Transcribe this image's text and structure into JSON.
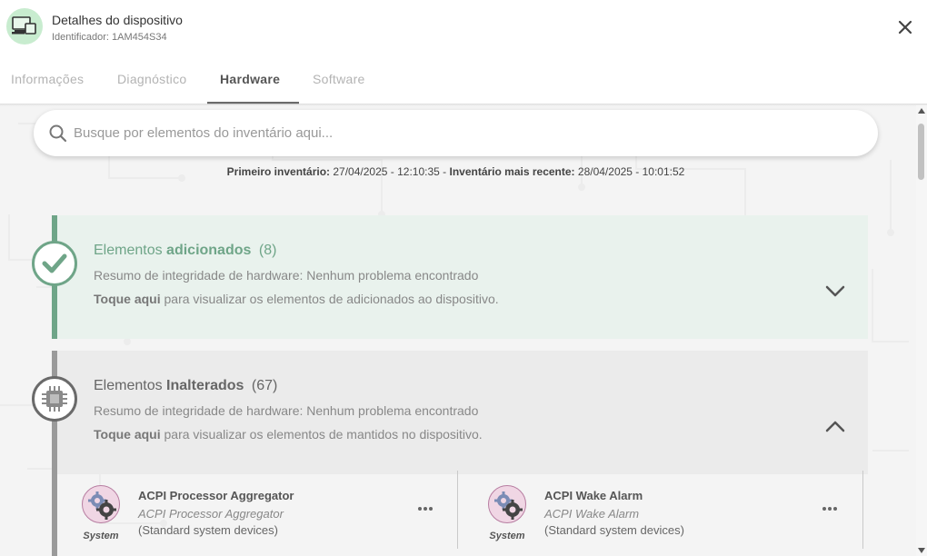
{
  "header": {
    "title": "Detalhes do dispositivo",
    "subtitle": "Identificador: 1AM454S34",
    "icon": "devices-icon",
    "close_icon": "close-icon"
  },
  "tabs": [
    {
      "label": "Informações",
      "active": false
    },
    {
      "label": "Diagnóstico",
      "active": false
    },
    {
      "label": "Hardware",
      "active": true
    },
    {
      "label": "Software",
      "active": false
    }
  ],
  "search": {
    "placeholder": "Busque por elementos do inventário aqui..."
  },
  "inventory": {
    "first_label": "Primeiro inventário:",
    "first_value": "27/04/2025 - 12:10:35",
    "separator": "-",
    "recent_label": "Inventário mais recente:",
    "recent_value": "28/04/2025 - 10:01:52"
  },
  "sections": [
    {
      "id": "added",
      "title_prefix": "Elementos",
      "title_bold": "adicionados",
      "count": "(8)",
      "summary": "Resumo de integridade de hardware: Nenhum problema encontrado",
      "tap_bold": "Toque aqui",
      "tap_rest": "para visualizar os elementos de adicionados ao dispositivo.",
      "expanded": false,
      "color": "#6fa588",
      "icon": "check-icon"
    },
    {
      "id": "unchanged",
      "title_prefix": "Elementos",
      "title_bold": "Inalterados",
      "count": "(67)",
      "summary": "Resumo de integridade de hardware: Nenhum problema encontrado",
      "tap_bold": "Toque aqui",
      "tap_rest": "para visualizar os elementos de mantidos no dispositivo.",
      "expanded": true,
      "color": "#6a6a6a",
      "icon": "chip-icon"
    }
  ],
  "cards": [
    {
      "name": "ACPI Processor Aggregator",
      "description": "ACPI Processor Aggregator",
      "category": "(Standard system devices)",
      "type_label": "System",
      "icon": "gears-icon"
    },
    {
      "name": "ACPI Wake Alarm",
      "description": "ACPI Wake Alarm",
      "category": "(Standard system devices)",
      "type_label": "System",
      "icon": "gears-icon"
    }
  ],
  "colors": {
    "accent_green": "#6fa588",
    "avatar_bg": "#c8eccf",
    "tab_indicator": "#6b6b6b"
  }
}
